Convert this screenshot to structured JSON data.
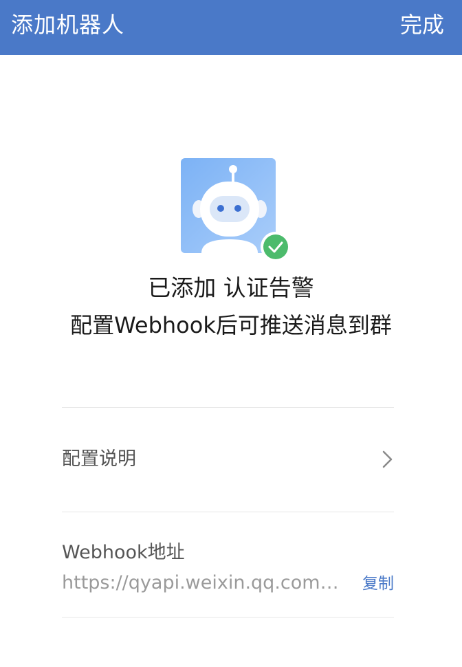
{
  "header": {
    "title": "添加机器人",
    "done_label": "完成",
    "bg_color": "#4a79c8"
  },
  "robot": {
    "avatar_icon": "robot-avatar-icon",
    "status_icon": "check-circle-icon",
    "status_color": "#4cbb6c"
  },
  "status": {
    "added_text": "已添加 认证告警",
    "hint_text": "配置Webhook后可推送消息到群"
  },
  "config_row": {
    "label": "配置说明",
    "icon": "chevron-right-icon"
  },
  "webhook": {
    "label": "Webhook地址",
    "url": "https://qyapi.weixin.qq.com/c…",
    "copy_label": "复制",
    "link_color": "#4a79c8"
  }
}
